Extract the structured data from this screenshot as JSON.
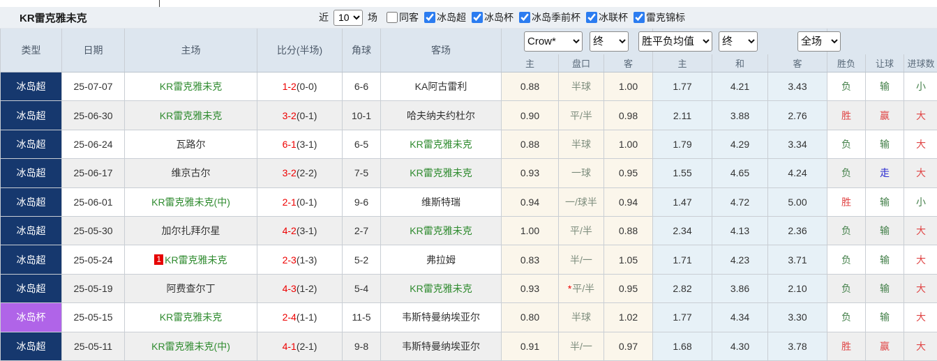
{
  "title": "KR雷克雅未克",
  "filter_bar": {
    "recent_label": "近",
    "recent_value": "10",
    "matches_label": "场",
    "checkboxes": [
      {
        "label": "同客",
        "checked": false
      },
      {
        "label": "冰岛超",
        "checked": true
      },
      {
        "label": "冰岛杯",
        "checked": true
      },
      {
        "label": "冰岛季前杯",
        "checked": true
      },
      {
        "label": "冰联杯",
        "checked": true
      },
      {
        "label": "雷克锦标",
        "checked": true
      }
    ]
  },
  "table": {
    "columns": [
      "类型",
      "日期",
      "主场",
      "比分(半场)",
      "角球",
      "客场"
    ],
    "odds_header": {
      "bookmaker_select": "Crow*",
      "bookmaker_time_select": "终",
      "europe_select": "胜平负均值",
      "europe_time_select": "终",
      "period_select": "全场"
    },
    "sub_columns": [
      "主",
      "盘口",
      "客",
      "主",
      "和",
      "客",
      "胜负",
      "让球",
      "进球数"
    ],
    "rows": [
      {
        "type": "冰岛超",
        "cup": false,
        "date": "25-07-07",
        "home": "KR雷克雅未克",
        "home_team": true,
        "red_card": "",
        "score": "1-2",
        "half": "(0-0)",
        "corner": "6-6",
        "away": "KA阿古雷利",
        "away_team": false,
        "ah_home": "0.88",
        "ah_line": "半球",
        "ah_star": false,
        "ah_away": "1.00",
        "eu_home": "1.77",
        "eu_draw": "4.21",
        "eu_away": "3.43",
        "r_wdl": "负",
        "r_ah": "输",
        "r_ou": "小"
      },
      {
        "type": "冰岛超",
        "cup": false,
        "date": "25-06-30",
        "home": "KR雷克雅未克",
        "home_team": true,
        "red_card": "",
        "score": "3-2",
        "half": "(0-1)",
        "corner": "10-1",
        "away": "哈夫纳夫约杜尔",
        "away_team": false,
        "ah_home": "0.90",
        "ah_line": "平/半",
        "ah_star": false,
        "ah_away": "0.98",
        "eu_home": "2.11",
        "eu_draw": "3.88",
        "eu_away": "2.76",
        "r_wdl": "胜",
        "r_ah": "赢",
        "r_ou": "大"
      },
      {
        "type": "冰岛超",
        "cup": false,
        "date": "25-06-24",
        "home": "瓦路尔",
        "home_team": false,
        "red_card": "",
        "score": "6-1",
        "half": "(3-1)",
        "corner": "6-5",
        "away": "KR雷克雅未克",
        "away_team": true,
        "ah_home": "0.88",
        "ah_line": "半球",
        "ah_star": false,
        "ah_away": "1.00",
        "eu_home": "1.79",
        "eu_draw": "4.29",
        "eu_away": "3.34",
        "r_wdl": "负",
        "r_ah": "输",
        "r_ou": "大"
      },
      {
        "type": "冰岛超",
        "cup": false,
        "date": "25-06-17",
        "home": "维京古尔",
        "home_team": false,
        "red_card": "",
        "score": "3-2",
        "half": "(2-2)",
        "corner": "7-5",
        "away": "KR雷克雅未克",
        "away_team": true,
        "ah_home": "0.93",
        "ah_line": "一球",
        "ah_star": false,
        "ah_away": "0.95",
        "eu_home": "1.55",
        "eu_draw": "4.65",
        "eu_away": "4.24",
        "r_wdl": "负",
        "r_ah": "走",
        "r_ou": "大"
      },
      {
        "type": "冰岛超",
        "cup": false,
        "date": "25-06-01",
        "home": "KR雷克雅未克(中)",
        "home_team": true,
        "red_card": "",
        "score": "2-1",
        "half": "(0-1)",
        "corner": "9-6",
        "away": "维斯特瑞",
        "away_team": false,
        "ah_home": "0.94",
        "ah_line": "一/球半",
        "ah_star": false,
        "ah_away": "0.94",
        "eu_home": "1.47",
        "eu_draw": "4.72",
        "eu_away": "5.00",
        "r_wdl": "胜",
        "r_ah": "输",
        "r_ou": "小"
      },
      {
        "type": "冰岛超",
        "cup": false,
        "date": "25-05-30",
        "home": "加尔扎拜尔星",
        "home_team": false,
        "red_card": "",
        "score": "4-2",
        "half": "(3-1)",
        "corner": "2-7",
        "away": "KR雷克雅未克",
        "away_team": true,
        "ah_home": "1.00",
        "ah_line": "平/半",
        "ah_star": false,
        "ah_away": "0.88",
        "eu_home": "2.34",
        "eu_draw": "4.13",
        "eu_away": "2.36",
        "r_wdl": "负",
        "r_ah": "输",
        "r_ou": "大"
      },
      {
        "type": "冰岛超",
        "cup": false,
        "date": "25-05-24",
        "home": "KR雷克雅未克",
        "home_team": true,
        "red_card": "1",
        "score": "2-3",
        "half": "(1-3)",
        "corner": "5-2",
        "away": "弗拉姆",
        "away_team": false,
        "ah_home": "0.83",
        "ah_line": "半/一",
        "ah_star": false,
        "ah_away": "1.05",
        "eu_home": "1.71",
        "eu_draw": "4.23",
        "eu_away": "3.71",
        "r_wdl": "负",
        "r_ah": "输",
        "r_ou": "大"
      },
      {
        "type": "冰岛超",
        "cup": false,
        "date": "25-05-19",
        "home": "阿费查尔丁",
        "home_team": false,
        "red_card": "",
        "score": "4-3",
        "half": "(1-2)",
        "corner": "5-4",
        "away": "KR雷克雅未克",
        "away_team": true,
        "ah_home": "0.93",
        "ah_line": "平/半",
        "ah_star": true,
        "ah_away": "0.95",
        "eu_home": "2.82",
        "eu_draw": "3.86",
        "eu_away": "2.10",
        "r_wdl": "负",
        "r_ah": "输",
        "r_ou": "大"
      },
      {
        "type": "冰岛杯",
        "cup": true,
        "date": "25-05-15",
        "home": "KR雷克雅未克",
        "home_team": true,
        "red_card": "",
        "score": "2-4",
        "half": "(1-1)",
        "corner": "11-5",
        "away": "韦斯特曼纳埃亚尔",
        "away_team": false,
        "ah_home": "0.80",
        "ah_line": "半球",
        "ah_star": false,
        "ah_away": "1.02",
        "eu_home": "1.77",
        "eu_draw": "4.34",
        "eu_away": "3.30",
        "r_wdl": "负",
        "r_ah": "输",
        "r_ou": "大"
      },
      {
        "type": "冰岛超",
        "cup": false,
        "date": "25-05-11",
        "home": "KR雷克雅未克(中)",
        "home_team": true,
        "red_card": "",
        "score": "4-1",
        "half": "(2-1)",
        "corner": "9-8",
        "away": "韦斯特曼纳埃亚尔",
        "away_team": false,
        "ah_home": "0.91",
        "ah_line": "半/一",
        "ah_star": false,
        "ah_away": "0.97",
        "eu_home": "1.68",
        "eu_draw": "4.30",
        "eu_away": "3.78",
        "r_wdl": "胜",
        "r_ah": "赢",
        "r_ou": "大"
      }
    ]
  },
  "colors": {
    "navy": "#16386e",
    "purple": "#b064e8",
    "green": "#2f8b2f",
    "scoreRed": "#ee0000",
    "resRed": "#e04545",
    "resGreen": "#44804a",
    "resBlue": "#2a2ad0",
    "cream": "#fbf6eb",
    "lblue": "#e7f1f7",
    "accent": "#2b7cf0"
  }
}
